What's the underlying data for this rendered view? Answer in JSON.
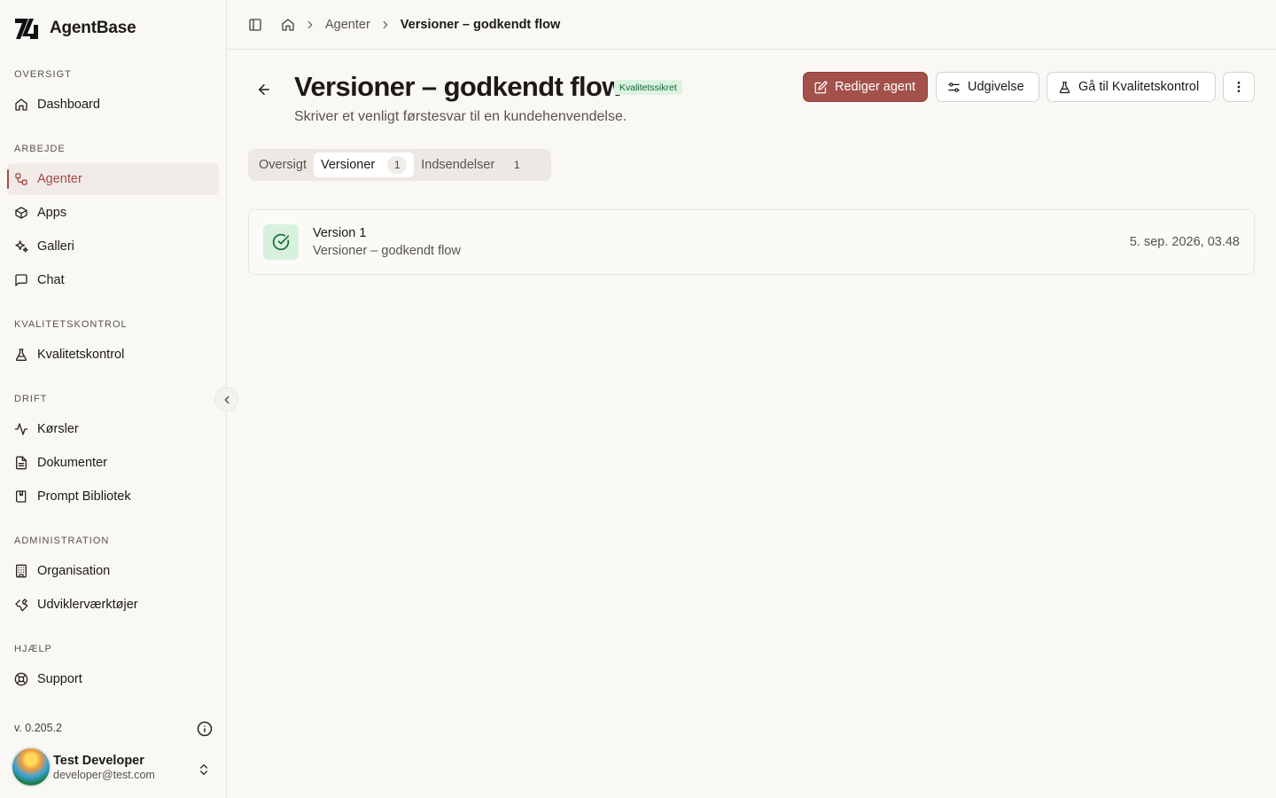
{
  "brand": {
    "name": "AgentBase"
  },
  "sidebar": {
    "sections": [
      {
        "label": "OVERSIGT",
        "items": [
          {
            "label": "Dashboard",
            "icon": "home-icon"
          }
        ]
      },
      {
        "label": "ARBEJDE",
        "items": [
          {
            "label": "Agenter",
            "icon": "workflow-icon",
            "active": true
          },
          {
            "label": "Apps",
            "icon": "box-icon"
          },
          {
            "label": "Galleri",
            "icon": "sparkles-icon"
          },
          {
            "label": "Chat",
            "icon": "message-icon"
          }
        ]
      },
      {
        "label": "KVALITETSKONTROL",
        "items": [
          {
            "label": "Kvalitetskontrol",
            "icon": "flask-icon"
          }
        ]
      },
      {
        "label": "DRIFT",
        "items": [
          {
            "label": "Kørsler",
            "icon": "activity-icon"
          },
          {
            "label": "Dokumenter",
            "icon": "file-icon"
          },
          {
            "label": "Prompt Bibliotek",
            "icon": "book-icon"
          }
        ]
      },
      {
        "label": "ADMINISTRATION",
        "items": [
          {
            "label": "Organisation",
            "icon": "building-icon"
          },
          {
            "label": "Udviklerværktøjer",
            "icon": "wrench-icon"
          }
        ]
      },
      {
        "label": "HJÆLP",
        "items": [
          {
            "label": "Support",
            "icon": "lifebuoy-icon"
          }
        ]
      }
    ],
    "version": "v. 0.205.2",
    "user": {
      "name": "Test Developer",
      "email": "developer@test.com"
    }
  },
  "breadcrumb": {
    "items": [
      "Agenter"
    ],
    "current": "Versioner – godkendt flow"
  },
  "header": {
    "title": "Versioner – godkendt flow",
    "badge": "Kvalitetssikret",
    "subtitle": "Skriver et venligt førstesvar til en kundehenvendelse.",
    "buttons": {
      "edit": "Rediger agent",
      "release": "Udgivelse",
      "qa": "Gå til Kvalitetskontrol"
    }
  },
  "tabs": [
    {
      "label": "Oversigt"
    },
    {
      "label": "Versioner",
      "count": "1",
      "active": true
    },
    {
      "label": "Indsendelser",
      "count": "1"
    }
  ],
  "versions": [
    {
      "title": "Version 1",
      "subtitle": "Versioner – godkendt flow",
      "date": "5. sep. 2026, 03.48"
    }
  ],
  "colors": {
    "accent": "#a4504b",
    "success_bg": "#d8f1df",
    "success": "#166534",
    "background": "#faf8f5"
  }
}
